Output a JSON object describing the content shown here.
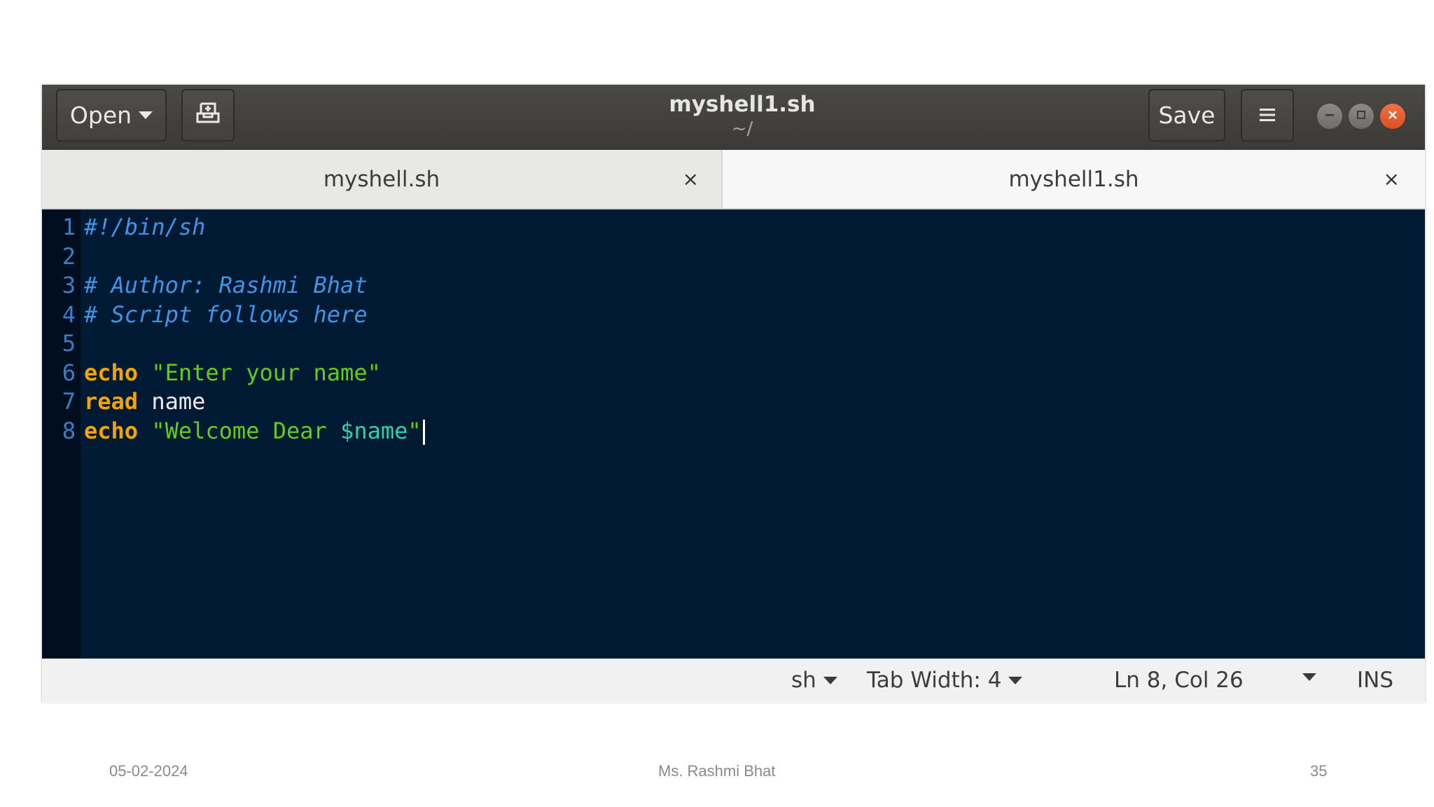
{
  "header": {
    "open_label": "Open",
    "save_label": "Save",
    "title": "myshell1.sh",
    "subtitle": "~/"
  },
  "tabs": [
    {
      "label": "myshell.sh",
      "active": false,
      "close": "×"
    },
    {
      "label": "myshell1.sh",
      "active": true,
      "close": "×"
    }
  ],
  "editor": {
    "line_numbers": [
      "1",
      "2",
      "3",
      "4",
      "5",
      "6",
      "7",
      "8"
    ],
    "line1": "#!/bin/sh",
    "line3": "# Author: Rashmi Bhat",
    "line4": "# Script follows here",
    "line6_kw": "echo",
    "line6_str": "\"Enter your name\"",
    "line7_kw": "read",
    "line7_arg": "name",
    "line8_kw": "echo",
    "line8_str_a": "\"Welcome Dear ",
    "line8_var": "$name",
    "line8_str_b": "\""
  },
  "statusbar": {
    "language": "sh",
    "tab_width": "Tab Width: 4",
    "position": "Ln 8, Col 26",
    "mode": "INS"
  },
  "footer": {
    "date": "05-02-2024",
    "author": "Ms. Rashmi Bhat",
    "page": "35"
  },
  "colors": {
    "editor_bg": "#011a33",
    "comment": "#3d94e8",
    "keyword": "#f2a400",
    "string": "#5fcf17",
    "variable": "#2fd0b0",
    "close_button": "#e95420"
  },
  "icons": [
    "new-document-icon",
    "hamburger-menu-icon",
    "minimize-icon",
    "maximize-icon",
    "close-icon"
  ]
}
